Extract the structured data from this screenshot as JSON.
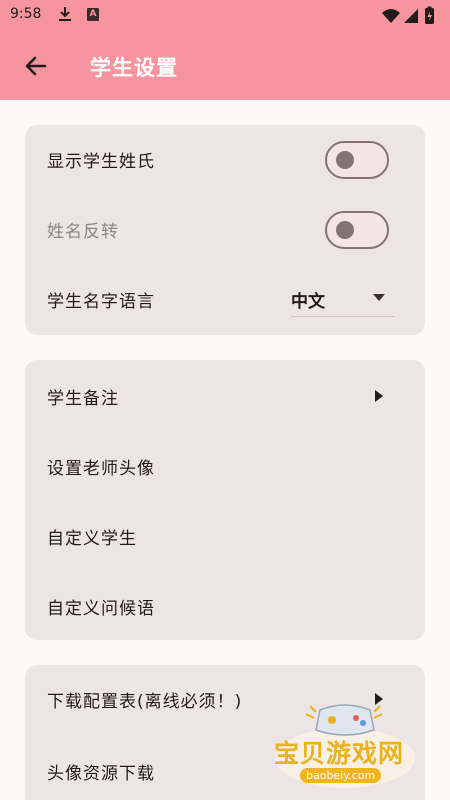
{
  "status_bar": {
    "time": "9:58",
    "download_icon": "download-icon",
    "app_badge": "A"
  },
  "app_bar": {
    "title": "学生设置",
    "back_icon": "arrow-back-icon"
  },
  "section1": {
    "show_surname": {
      "label": "显示学生姓氏",
      "checked": false
    },
    "reverse_name": {
      "label": "姓名反转",
      "checked": false,
      "disabled": true
    },
    "name_language": {
      "label": "学生名字语言",
      "value": "中文"
    }
  },
  "section2": {
    "items": [
      {
        "label": "学生备注",
        "has_chevron": true
      },
      {
        "label": "设置老师头像",
        "has_chevron": false
      },
      {
        "label": "自定义学生",
        "has_chevron": false
      },
      {
        "label": "自定义问候语",
        "has_chevron": false
      }
    ]
  },
  "section3": {
    "items": [
      {
        "label": "下载配置表(离线必须！)",
        "has_chevron": true
      },
      {
        "label": "头像资源下载",
        "has_chevron": false
      }
    ]
  },
  "watermark": {
    "text": "宝贝游戏网",
    "url": "baobeiy.com"
  },
  "colors": {
    "app_bar": "#f7959f",
    "card": "#ede4e4",
    "background": "#fff8f7",
    "toggle_outline": "#857373"
  }
}
